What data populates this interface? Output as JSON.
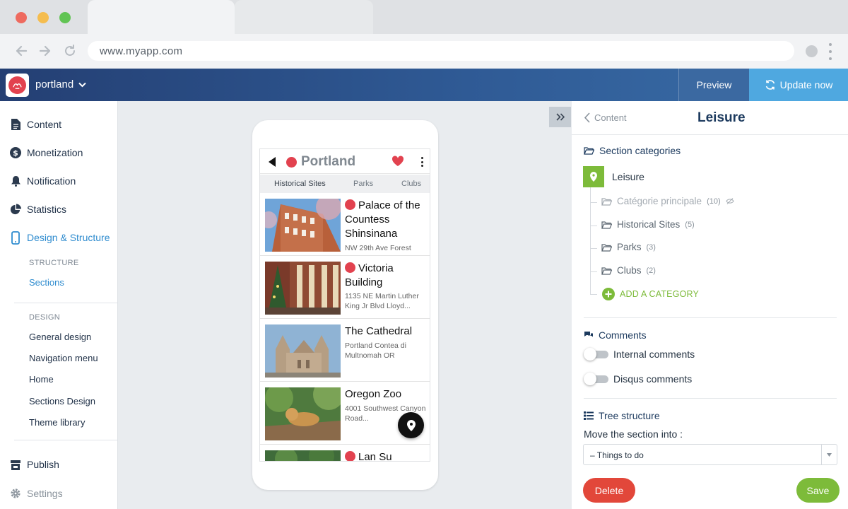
{
  "browser": {
    "url": "www.myapp.com"
  },
  "header": {
    "app_name": "portland",
    "preview_label": "Preview",
    "update_label": "Update now"
  },
  "sidebar": {
    "items": {
      "content": "Content",
      "monetization": "Monetization",
      "notification": "Notification",
      "statistics": "Statistics",
      "design": "Design & Structure",
      "publish": "Publish",
      "settings": "Settings"
    },
    "structure_heading": "STRUCTURE",
    "structure_items": [
      "Sections"
    ],
    "design_heading": "DESIGN",
    "design_items": [
      "General design",
      "Navigation menu",
      "Home",
      "Sections Design",
      "Theme library"
    ]
  },
  "phone": {
    "title": "Portland",
    "tabs": [
      "Historical Sites",
      "Parks",
      "Clubs"
    ],
    "cards": [
      {
        "title": "Palace of the Countess Shinsinana",
        "subtitle": "NW 29th Ave Forest",
        "has_logo": true
      },
      {
        "title": "Victoria Building",
        "subtitle": "1135 NE Martin Luther King Jr Blvd Lloyd...",
        "has_logo": true
      },
      {
        "title": "The Cathedral",
        "subtitle": "Portland Contea di Multnomah OR",
        "has_logo": false
      },
      {
        "title": "Oregon Zoo",
        "subtitle": "4001 Southwest Canyon Road...",
        "has_logo": false
      },
      {
        "title": "Lan Su",
        "subtitle": "",
        "has_logo": true
      }
    ]
  },
  "panel": {
    "back_label": "Content",
    "title": "Leisure",
    "section_categories_label": "Section categories",
    "root_category": "Leisure",
    "categories": [
      {
        "name": "Catégorie principale",
        "count": "(10)",
        "hidden": true
      },
      {
        "name": "Historical Sites",
        "count": "(5)",
        "hidden": false
      },
      {
        "name": "Parks",
        "count": "(3)",
        "hidden": false
      },
      {
        "name": "Clubs",
        "count": "(2)",
        "hidden": false
      }
    ],
    "add_category_label": "ADD A CATEGORY",
    "comments_label": "Comments",
    "internal_comments_label": "Internal comments",
    "internal_comments_on": false,
    "disqus_comments_label": "Disqus comments",
    "disqus_comments_on": false,
    "tree_structure_label": "Tree structure",
    "move_label": "Move the section into :",
    "move_value": "– Things to do",
    "delete_label": "Delete",
    "save_label": "Save"
  },
  "colors": {
    "header_start": "#243f73",
    "header_end": "#3a6ea8",
    "accent_blue": "#2f8ccf",
    "update_blue": "#4fa8e0",
    "brand_red": "#e2424f",
    "green": "#7dbb3a",
    "delete_red": "#e2473a"
  },
  "icons": {
    "window_controls": [
      "close-light",
      "minimize-light",
      "maximize-light"
    ],
    "nav": [
      "back-arrow-icon",
      "forward-arrow-icon",
      "reload-icon"
    ],
    "sidebar": [
      "document-icon",
      "dollar-icon",
      "bell-icon",
      "pie-chart-icon",
      "phone-icon",
      "store-icon",
      "gear-icon"
    ]
  }
}
